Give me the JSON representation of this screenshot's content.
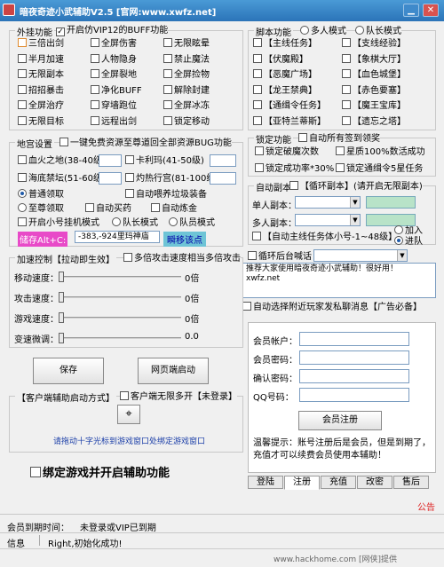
{
  "app": {
    "title": "暗夜奇迹小武辅助V2.5   [官网:www.xwfz.net]"
  },
  "outer": {
    "title": "外挂功能",
    "vip_label": "开启仿VIP12的BUFF功能",
    "items": [
      "三倍出剑",
      "全屏伤害",
      "无限眩晕",
      "半月加速",
      "人物隐身",
      "禁止魔法",
      "无限副本",
      "全屏裂地",
      "全屏捡物",
      "招招暴击",
      "净化BUFF",
      "解除封建",
      "全屏治疗",
      "穿墙跑位",
      "全屏冰冻",
      "无限目标",
      "远程出剑",
      "锁定移动"
    ]
  },
  "script_group": {
    "title": "脚本功能",
    "mode_multi": "多人模式",
    "mode_leader": "队长模式",
    "items": [
      "【主线任务】",
      "【支线经验】",
      "【伏魔殿】",
      "【象棋大厅】",
      "【恶魔广场】",
      "【血色城堡】",
      "【龙王禁典】",
      "【赤色要塞】",
      "【通缉令任务】",
      "【魔王宝库】",
      "【亚特兰蒂斯】",
      "【遗忘之塔】"
    ]
  },
  "map_group": {
    "title": "地宫设置",
    "free_label": "一键免费资源至尊道回全部资源BUG功能",
    "maps": [
      {
        "name": "血火之地(38-40级)",
        "value": ""
      },
      {
        "name": "卡利玛(41-50级)",
        "value": ""
      },
      {
        "name": "海底禁坛(51-60级)",
        "value": ""
      },
      {
        "name": "灼热行宫(81-100级)",
        "value": ""
      }
    ],
    "normal": "普通领取",
    "auto_feed": "自动喂养垃圾装备",
    "supreme": "至尊领取",
    "auto_buy": "自动买药",
    "auto_refine": "自动炼金",
    "open_hook": "开启小号挂机模式",
    "team_leader": "队长模式",
    "team_member": "队员模式",
    "store_label": "储存Alt+C:",
    "coords": "-383,-924里玛神庙",
    "move_label": "瞬移该点"
  },
  "lock_group": {
    "title": "锁定功能",
    "auto_sign": "自动所有签到领奖",
    "lock_break": "锁定破魔次数",
    "star_100": "星质100%数活成功",
    "lock_rate": "锁定成功率*30%",
    "lock_wanted": "锁定通缉令5星任务"
  },
  "auto_group": {
    "title": "自动副本",
    "loop": "【循环副本】(请开启无限副本)",
    "single": "单人副本：",
    "multi": "多人副本：",
    "auto_main": "【自动主线任务体小号-1~48级】",
    "join": "加入",
    "leave": "进队"
  },
  "loop_talk": {
    "label": "循环后台喊话",
    "message": "推荐大家使用暗夜奇迹小武辅助！很好用！\nxwfz.net"
  },
  "accept_label": "自动选择附近玩家发私聊消息【广告必备】",
  "speed_group": {
    "title": "加速控制",
    "master": "【拉动即生效】",
    "multi_speed": "多倍攻击速度相当多倍攻击",
    "rows": [
      {
        "label": "移动速度：",
        "value": "0倍",
        "level": 0
      },
      {
        "label": "攻击速度：",
        "value": "0倍",
        "level": 0
      },
      {
        "label": "游戏速度：",
        "value": "0倍",
        "level": 0
      },
      {
        "label": "变速微调：",
        "value": "0.0",
        "level": 0
      }
    ]
  },
  "buttons": {
    "save": "保存",
    "web": "网页端启动"
  },
  "client_group": {
    "title": "【客户端辅助启动方式】",
    "multi_open": "客户端无限多开【未登录】",
    "hint": "请拖动十字光标到游戏窗口处绑定游戏窗口"
  },
  "bind_label": "绑定游戏并开启辅助功能",
  "register": {
    "account": "会员帐户：",
    "password": "会员密码：",
    "confirm": "确认密码：",
    "qq": "QQ号码：",
    "submit": "会员注册",
    "tip": "温馨提示：账号注册后是会员，但是到期了，充值才可以续费会员使用本辅助！"
  },
  "tabs": [
    "登陆",
    "注册",
    "充值",
    "改密",
    "售后"
  ],
  "announcement": "公告",
  "expiry": {
    "label": "会员到期时间：",
    "value": "未登录或VIP已到期"
  },
  "status": {
    "label": "信息",
    "value": "Right,初始化成功!"
  },
  "watermark": "www.hackhome.com [网侠]提供"
}
